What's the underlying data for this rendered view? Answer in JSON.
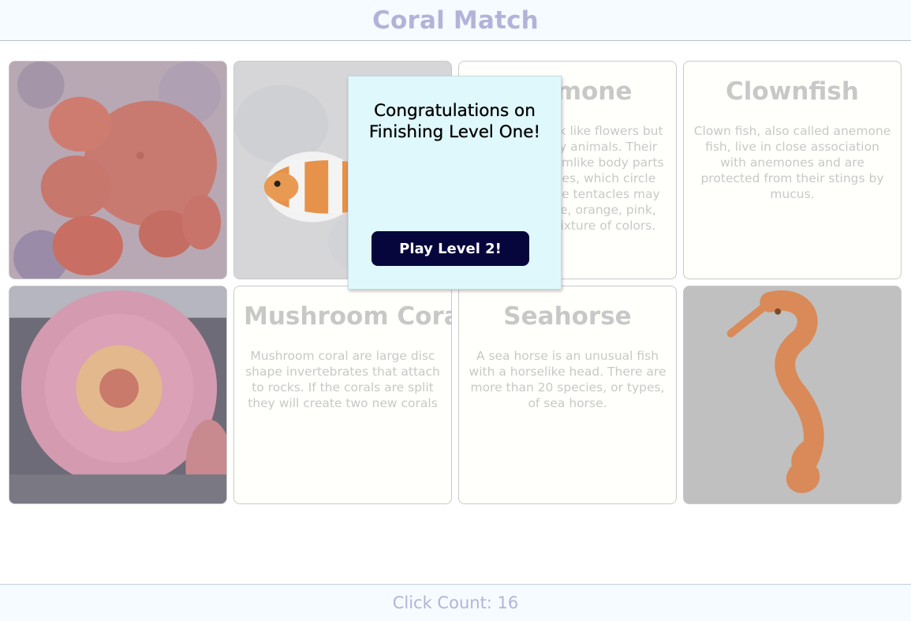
{
  "header": {
    "title": "Coral Match"
  },
  "cards": [
    {
      "kind": "image",
      "icon": "mushroom-coral-image"
    },
    {
      "kind": "image",
      "icon": "clownfish-image"
    },
    {
      "kind": "text",
      "title": "Anemone",
      "body": "Anemones look like flowers but they are really animals. Their bodies have armlike body parts called tentacles, which circle the mouth. The tentacles may be green, blue, orange, pink, white, or a mixture of colors."
    },
    {
      "kind": "text",
      "title": "Clownfish",
      "body": "Clown fish, also called anemone fish, live in close association with anemones and are protected from their stings by mucus."
    },
    {
      "kind": "image",
      "icon": "anemone-image"
    },
    {
      "kind": "text",
      "title": "Mushroom Coral",
      "body": "Mushroom coral are large disc shape invertebrates that attach to rocks. If the corals are split they will create two new corals"
    },
    {
      "kind": "text",
      "title": "Seahorse",
      "body": "A sea horse is an unusual fish with a horselike head. There are more than 20 species, or types, of sea horse."
    },
    {
      "kind": "image",
      "icon": "seahorse-image"
    }
  ],
  "modal": {
    "message": "Congratulations on Finishing Level One!",
    "button_label": "Play Level 2!"
  },
  "footer": {
    "click_count_label": "Click Count: 16"
  },
  "colors": {
    "accent": "#b3b3d9",
    "button": "#06063d",
    "modal_bg": "#dff8fc"
  }
}
